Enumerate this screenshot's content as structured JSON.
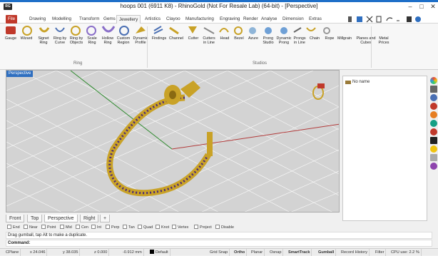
{
  "window": {
    "title": "hoops 001 (6911 K8) - RhinoGold (Not For Resale Lab) (64-bit) - [Perspective]",
    "app_icon_text": "RG"
  },
  "menu_tabs": [
    "File",
    "Drawing",
    "Modelling",
    "Transform",
    "Gems",
    "Jewellery",
    "Artistics",
    "Clayoo",
    "Manufacturing",
    "Engraving",
    "Render",
    "Analyse",
    "Dimension",
    "Extras"
  ],
  "ribbon": {
    "ring_group_label": "Ring",
    "studios_group_label": "Studios",
    "tools": [
      {
        "label": "Gauge"
      },
      {
        "label": "Wizard"
      },
      {
        "label": "Signet Ring"
      },
      {
        "label": "Ring by Curve"
      },
      {
        "label": "Ring by Objects"
      },
      {
        "label": "Scale Ring"
      },
      {
        "label": "Hollow Ring"
      },
      {
        "label": "Custom Region"
      },
      {
        "label": "Dynamic Profile"
      },
      {
        "label": "Findings"
      },
      {
        "label": "Channel"
      },
      {
        "label": "Cutter"
      },
      {
        "label": "Cutters in Line"
      },
      {
        "label": "Head"
      },
      {
        "label": "Bezel"
      },
      {
        "label": "Azure"
      },
      {
        "label": "Prong Studio"
      },
      {
        "label": "Dynamic Prong"
      },
      {
        "label": "Prongs in Line"
      },
      {
        "label": "Chain"
      },
      {
        "label": "Rope"
      },
      {
        "label": "Millgrain"
      },
      {
        "label": "Planes and Cubes"
      },
      {
        "label": "Metal Prices"
      }
    ]
  },
  "viewport": {
    "label": "Perspective",
    "tabs": [
      "Front",
      "Top",
      "Perspective",
      "Right",
      "+"
    ]
  },
  "layers": {
    "row_label": "No name",
    "swatch_color": "#9a7b3a"
  },
  "osnap": [
    "End",
    "Near",
    "Point",
    "Mid",
    "Cen",
    "Int",
    "Perp",
    "Tan",
    "Quad",
    "Knot",
    "Vertex",
    "Project",
    "Disable"
  ],
  "history_text": "Drag gumball, tap Alt to make a duplicate.",
  "command_label": "Command:",
  "status": {
    "cplane": "CPlane",
    "x": "x 24.046",
    "y": "y 38.035",
    "z": "z 0.000",
    "dist": "-0.912 mm",
    "layer": "Default",
    "toggles": [
      "Grid Snap",
      "Ortho",
      "Planar",
      "Osnap",
      "SmartTrack",
      "Gumball",
      "Record History",
      "Filter",
      "CPU use: 2.2 %"
    ]
  },
  "colors": {
    "accent": "#1e6fc8",
    "file_tab": "#c0392b",
    "viewport_bg": "#d3d3d3",
    "gold": "#c9a227",
    "gem": "#4b2a7a"
  }
}
